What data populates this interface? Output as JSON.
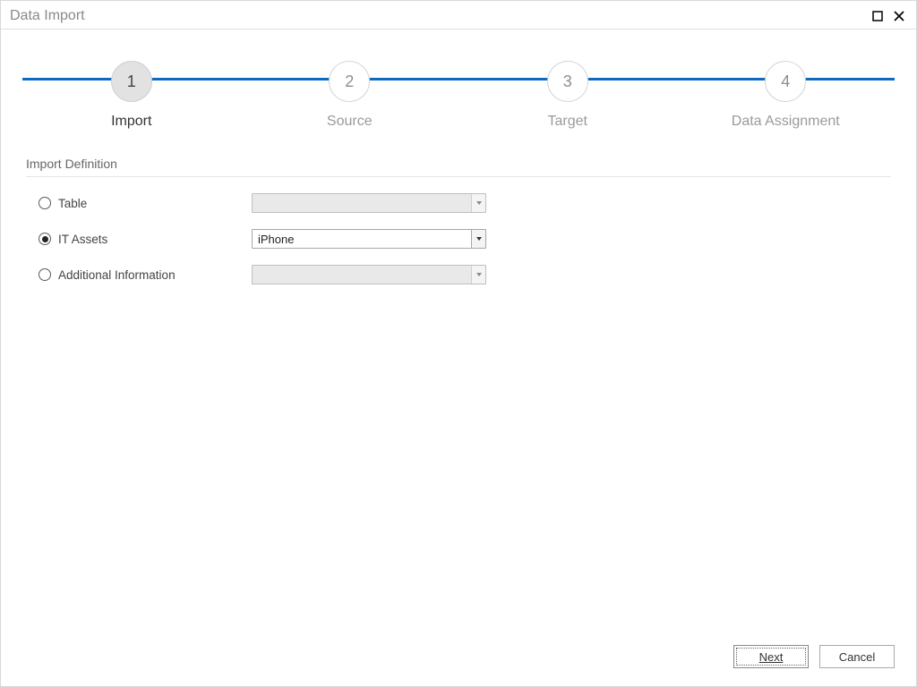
{
  "title": "Data Import",
  "steps": [
    {
      "num": "1",
      "label": "Import",
      "active": true
    },
    {
      "num": "2",
      "label": "Source",
      "active": false
    },
    {
      "num": "3",
      "label": "Target",
      "active": false
    },
    {
      "num": "4",
      "label": "Data Assignment",
      "active": false
    }
  ],
  "section_title": "Import Definition",
  "rows": {
    "table": {
      "label": "Table",
      "checked": false,
      "value": "",
      "enabled": false
    },
    "assets": {
      "label": "IT Assets",
      "checked": true,
      "value": "iPhone",
      "enabled": true
    },
    "additional": {
      "label": "Additional Information",
      "checked": false,
      "value": "",
      "enabled": false
    }
  },
  "buttons": {
    "next": "Next",
    "cancel": "Cancel"
  }
}
